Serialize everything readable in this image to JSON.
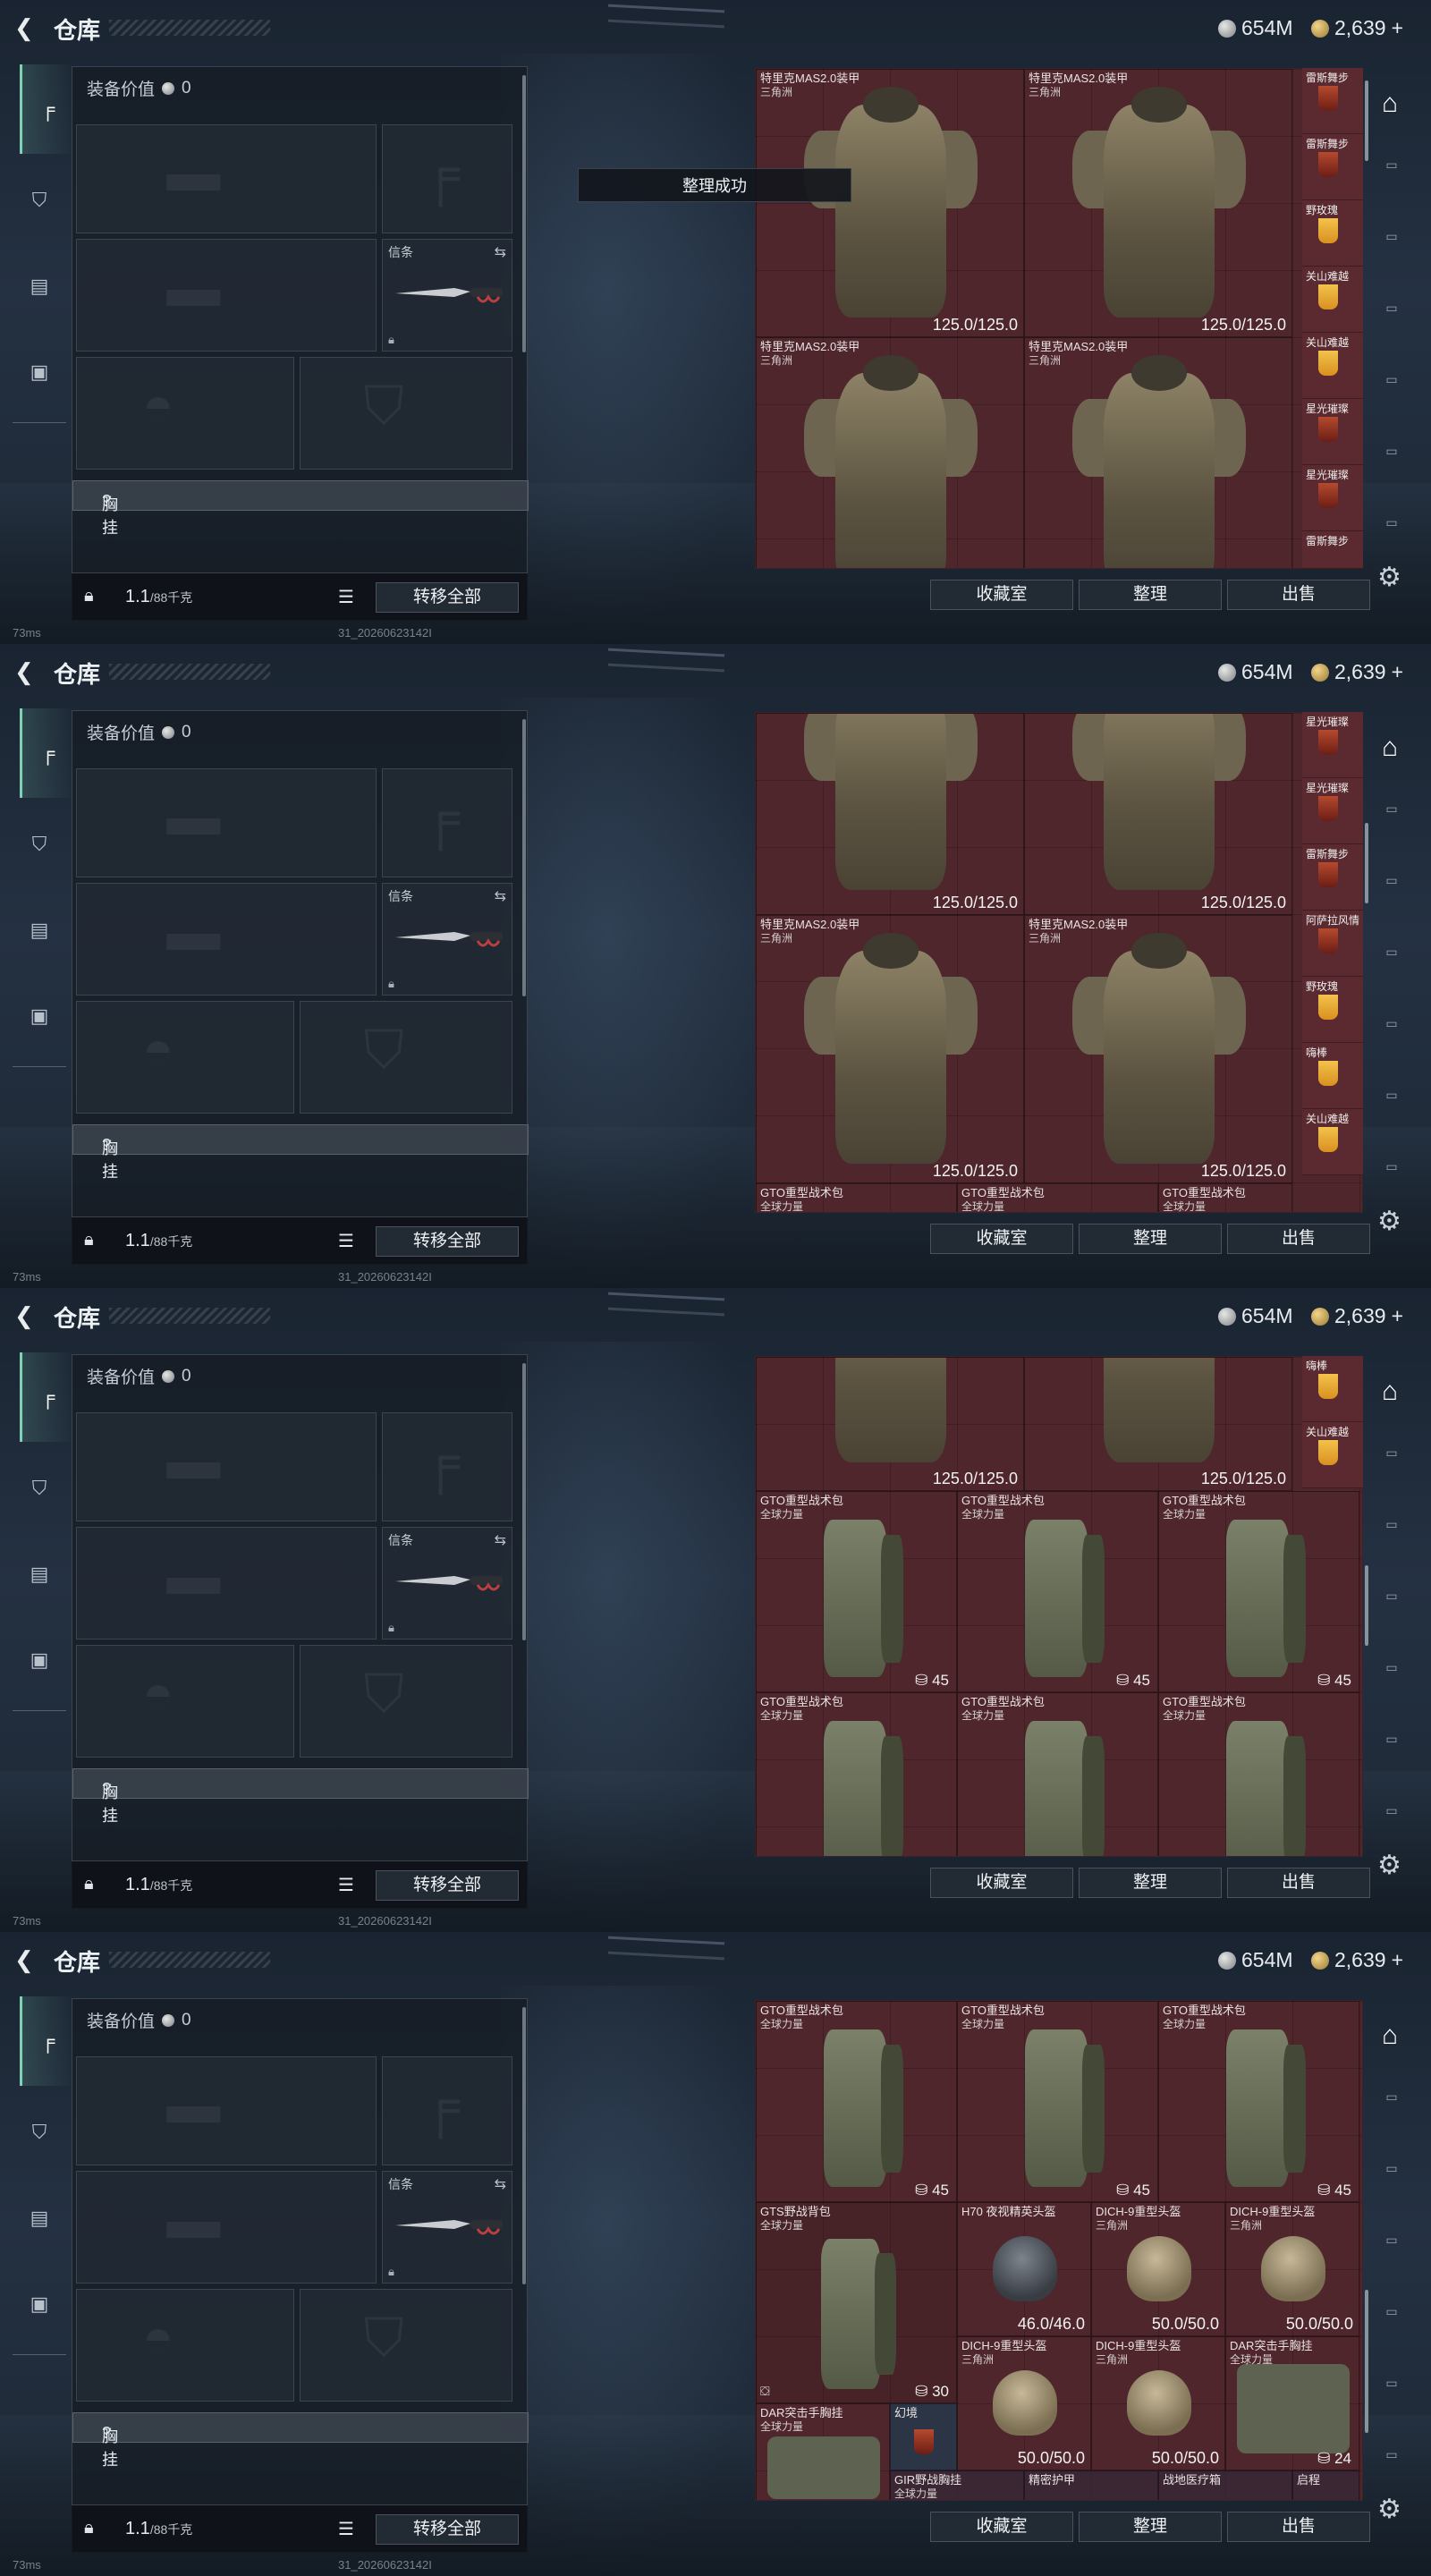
{
  "header": {
    "title": "仓库",
    "silver": "654M",
    "gold": "2,639",
    "gold_plus": "+"
  },
  "equipment": {
    "value_label": "装备价值",
    "value": "0",
    "melee_label": "信条",
    "chest_label": "胸挂",
    "chest_q": "?",
    "weight": "1.1",
    "weight_max": "/88千克",
    "transfer_all": "转移全部"
  },
  "stash": {
    "collection_btn": "收藏室",
    "sort_btn": "整理",
    "sell_btn": "出售"
  },
  "toast": "整理成功",
  "status": {
    "ping": "73ms",
    "build": "31_20260623142I"
  },
  "panels": [
    {
      "items": [
        {
          "name": "特里克MAS2.0装甲",
          "sub": "三角洲",
          "dur": "125.0/125.0",
          "kind": "vest"
        },
        {
          "name": "特里克MAS2.0装甲",
          "sub": "三角洲",
          "dur": "125.0/125.0",
          "kind": "vest"
        },
        {
          "name": "特里克MAS2.0装甲",
          "sub": "三角洲",
          "dur": "",
          "kind": "vest"
        },
        {
          "name": "特里克MAS2.0装甲",
          "sub": "三角洲",
          "dur": "",
          "kind": "vest"
        }
      ],
      "side": [
        "雷斯舞步",
        "雷斯舞步",
        "野玫瑰",
        "关山难越",
        "关山难越",
        "星光璀璨",
        "星光璀璨",
        "雷斯舞步"
      ]
    },
    {
      "items": [
        {
          "name": "",
          "sub": "",
          "dur": "125.0/125.0",
          "kind": "vest"
        },
        {
          "name": "",
          "sub": "",
          "dur": "125.0/125.0",
          "kind": "vest"
        },
        {
          "name": "特里克MAS2.0装甲",
          "sub": "三角洲",
          "dur": "125.0/125.0",
          "kind": "vest"
        },
        {
          "name": "特里克MAS2.0装甲",
          "sub": "三角洲",
          "dur": "125.0/125.0",
          "kind": "vest"
        }
      ],
      "bottom": [
        {
          "name": "GTO重型战术包",
          "sub": "全球力量"
        },
        {
          "name": "GTO重型战术包",
          "sub": "全球力量"
        },
        {
          "name": "GTO重型战术包",
          "sub": "全球力量"
        }
      ],
      "side": [
        "星光璀璨",
        "星光璀璨",
        "雷斯舞步",
        "阿萨拉风情",
        "野玫瑰",
        "嗨棒",
        "关山难越"
      ]
    },
    {
      "items": [
        {
          "name": "",
          "sub": "",
          "dur": "125.0/125.0",
          "kind": "vest"
        },
        {
          "name": "",
          "sub": "",
          "dur": "125.0/125.0",
          "kind": "vest"
        }
      ],
      "bags": [
        {
          "name": "GTO重型战术包",
          "sub": "全球力量",
          "cap": "45"
        },
        {
          "name": "GTO重型战术包",
          "sub": "全球力量",
          "cap": "45"
        },
        {
          "name": "GTO重型战术包",
          "sub": "全球力量",
          "cap": "45"
        },
        {
          "name": "GTO重型战术包",
          "sub": "全球力量",
          "cap": ""
        },
        {
          "name": "GTO重型战术包",
          "sub": "全球力量",
          "cap": ""
        },
        {
          "name": "GTO重型战术包",
          "sub": "全球力量",
          "cap": ""
        }
      ],
      "side": [
        "嗨棒",
        "关山难越"
      ]
    },
    {
      "bags": [
        {
          "name": "GTO重型战术包",
          "sub": "全球力量",
          "cap": "45"
        },
        {
          "name": "GTO重型战术包",
          "sub": "全球力量",
          "cap": "45"
        },
        {
          "name": "GTO重型战术包",
          "sub": "全球力量",
          "cap": "45"
        }
      ],
      "gts": {
        "name": "GTS野战背包",
        "sub": "全球力量",
        "cap": "30"
      },
      "h70": {
        "name": "H70 夜视精英头盔",
        "sub": "",
        "dur": "46.0/46.0"
      },
      "dich": [
        {
          "name": "DICH-9重型头盔",
          "sub": "三角洲",
          "dur": "50.0/50.0"
        },
        {
          "name": "DICH-9重型头盔",
          "sub": "三角洲",
          "dur": "50.0/50.0"
        },
        {
          "name": "DICH-9重型头盔",
          "sub": "三角洲",
          "dur": "50.0/50.0"
        },
        {
          "name": "DICH-9重型头盔",
          "sub": "三角洲",
          "dur": "50.0/50.0"
        }
      ],
      "dar": {
        "name": "DAR突击手胸挂",
        "sub": "全球力量",
        "cap": "24"
      },
      "dar2": {
        "name": "DAR突击手胸挂",
        "sub": "全球力量"
      },
      "illusion": "幻境",
      "bottom": [
        "GIR野战胸挂",
        "精密护甲",
        "战地医疗箱",
        "启程"
      ],
      "bottom_sub": "全球力量"
    }
  ]
}
